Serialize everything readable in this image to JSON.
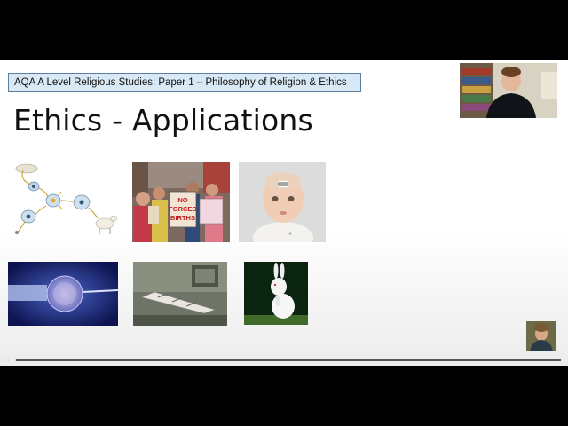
{
  "slide": {
    "course_label": "AQA A Level Religious Studies: Paper 1 – Philosophy of Religion & Ethics",
    "title": "Ethics - Applications",
    "protest_sign": [
      "NO",
      "FORCED",
      "BIRTHS"
    ]
  },
  "images": [
    {
      "icon": "cloning-diagram"
    },
    {
      "icon": "abortion-protest-photo"
    },
    {
      "icon": "baby-barcode-photo"
    },
    {
      "icon": "ivf-microscope-photo"
    },
    {
      "icon": "execution-chamber-photo"
    },
    {
      "icon": "white-rabbit-photo"
    }
  ],
  "video": {
    "progress": 0.01,
    "colors": {
      "track": "#555555",
      "fill": "#e0e0e0"
    }
  },
  "colors": {
    "label_bg": "#d8e8f4",
    "label_border": "#5b7fa3"
  }
}
